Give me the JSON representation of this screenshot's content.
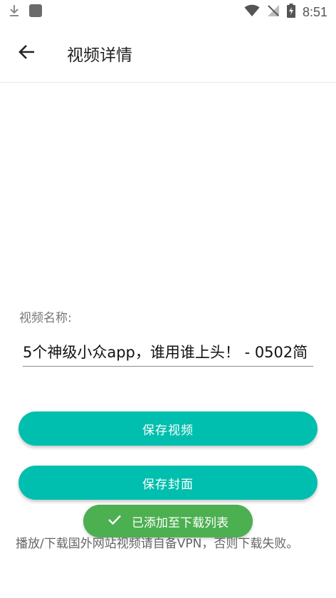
{
  "status_bar": {
    "time": "8:51",
    "icons": [
      "download-icon",
      "square-app-icon",
      "wifi-icon",
      "signal-off-icon",
      "battery-charging-icon"
    ]
  },
  "app_bar": {
    "title": "视频详情",
    "back_icon": "arrow-left-icon"
  },
  "form": {
    "name_label": "视频名称:",
    "name_value": "5个神级小众app，谁用谁上头！ - 0502简"
  },
  "buttons": {
    "save_video": "保存视频",
    "save_cover": "保存封面"
  },
  "notice": "播放/下载国外网站视频请自备VPN，否则下载失败。",
  "toast": {
    "message": "已添加至下载列表",
    "icon": "check-icon"
  },
  "colors": {
    "accent": "#00bfae",
    "toast": "#4caf50"
  }
}
